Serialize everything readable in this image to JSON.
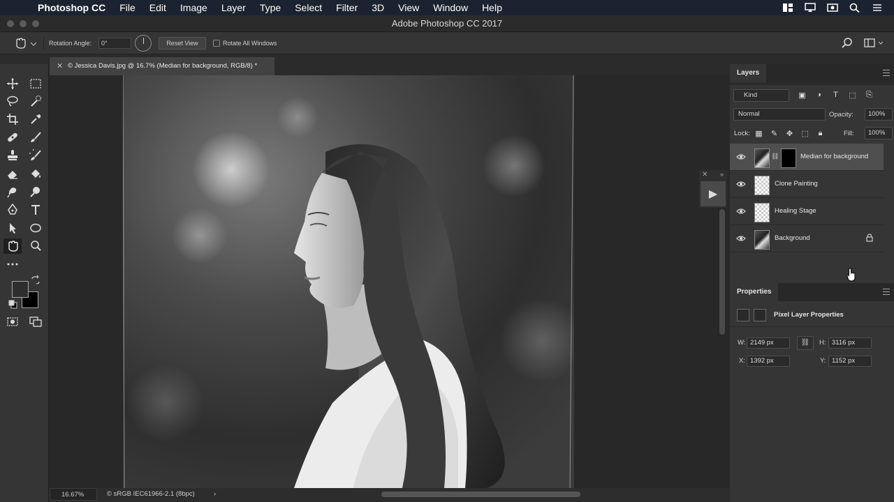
{
  "menubar": {
    "app_name": "Photoshop CC",
    "items": [
      "File",
      "Edit",
      "Image",
      "Layer",
      "Type",
      "Select",
      "Filter",
      "3D",
      "View",
      "Window",
      "Help"
    ]
  },
  "window": {
    "title": "Adobe Photoshop CC 2017"
  },
  "options": {
    "rotation_label": "Rotation Angle:",
    "rotation_value": "0°",
    "reset_view": "Reset View",
    "rotate_all_label": "Rotate All Windows",
    "rotate_all_checked": false
  },
  "document": {
    "tab_title": "© Jessica Davis.jpg @ 16.7% (Median for background, RGB/8) *",
    "zoom": "16.67%",
    "color_profile": "© sRGB IEC61966-2.1 (8bpc)"
  },
  "layers_panel": {
    "tab": "Layers",
    "filter": "Kind",
    "blend_mode": "Normal",
    "opacity_label": "Opacity:",
    "opacity": "100%",
    "lock_label": "Lock:",
    "fill_label": "Fill:",
    "fill": "100%",
    "layers": [
      {
        "name": "Median for background",
        "visible": true,
        "selected": true,
        "has_mask": true,
        "locked": false
      },
      {
        "name": "Clone Painting",
        "visible": true,
        "selected": false,
        "has_mask": false,
        "locked": false
      },
      {
        "name": "Healing Stage",
        "visible": true,
        "selected": false,
        "has_mask": false,
        "locked": false
      },
      {
        "name": "Background",
        "visible": true,
        "selected": false,
        "has_mask": false,
        "locked": true
      }
    ]
  },
  "properties_panel": {
    "tab": "Properties",
    "title": "Pixel Layer Properties",
    "w_label": "W:",
    "w": "2149 px",
    "h_label": "H:",
    "h": "3116 px",
    "x_label": "X:",
    "x": "1392 px",
    "y_label": "Y:",
    "y": "1152 px"
  },
  "colors": {
    "menubar": "#1b2330",
    "panel": "#353535",
    "selected_layer": "#4f4f4f",
    "foreground_swatch": "#2e2e2e",
    "background_swatch": "#000000"
  }
}
